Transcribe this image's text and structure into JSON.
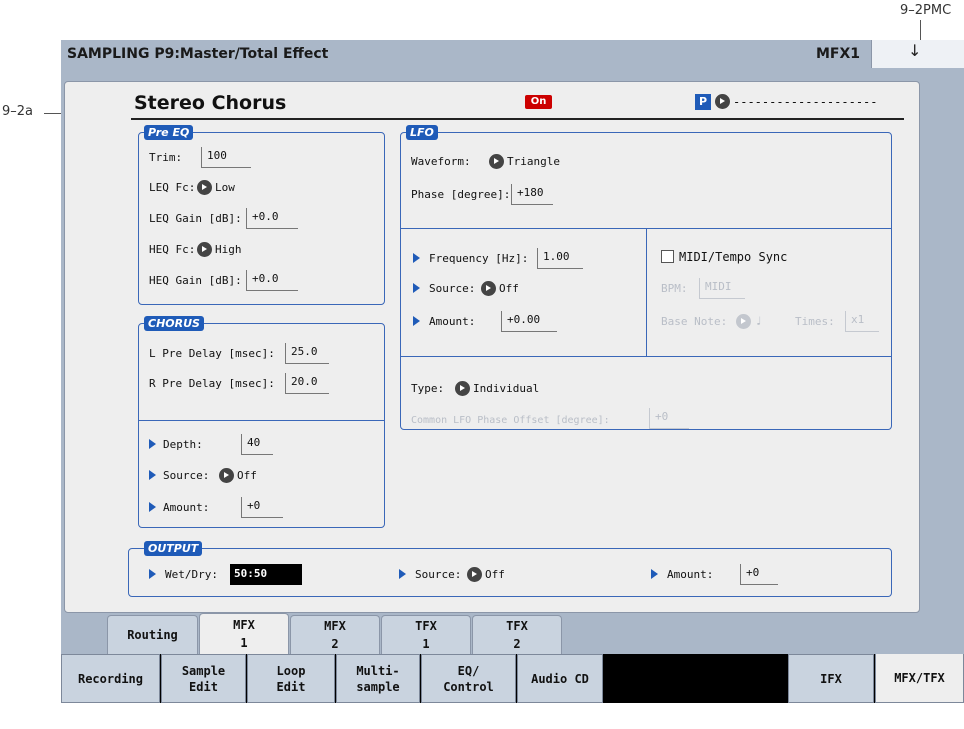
{
  "annotations": {
    "top_right": "9–2PMC",
    "left": "9–2a"
  },
  "titlebar": {
    "title": "SAMPLING P9:Master/Total Effect",
    "page_id": "MFX1"
  },
  "effect": {
    "name": "Stereo Chorus",
    "on_badge": "On",
    "p_badge": "P",
    "dashes": "--------------------"
  },
  "pre_eq": {
    "section": "Pre EQ",
    "trim_label": "Trim:",
    "trim_value": "100",
    "leq_fc_label": "LEQ Fc:",
    "leq_fc_value": "Low",
    "leq_gain_label": "LEQ Gain [dB]:",
    "leq_gain_value": "+0.0",
    "heq_fc_label": "HEQ Fc:",
    "heq_fc_value": "High",
    "heq_gain_label": "HEQ Gain [dB]:",
    "heq_gain_value": "+0.0"
  },
  "chorus": {
    "section": "CHORUS",
    "l_pre_delay_label": "L Pre Delay [msec]:",
    "l_pre_delay_value": "25.0",
    "r_pre_delay_label": "R Pre Delay [msec]:",
    "r_pre_delay_value": "20.0",
    "depth_label": "Depth:",
    "depth_value": "40",
    "source_label": "Source:",
    "source_value": "Off",
    "amount_label": "Amount:",
    "amount_value": "+0"
  },
  "lfo": {
    "section": "LFO",
    "waveform_label": "Waveform:",
    "waveform_value": "Triangle",
    "phase_label": "Phase [degree]:",
    "phase_value": "+180",
    "frequency_label": "Frequency [Hz]:",
    "frequency_value": "1.00",
    "source_label": "Source:",
    "source_value": "Off",
    "amount_label": "Amount:",
    "amount_value": "+0.00",
    "midi_sync_label": "MIDI/Tempo Sync",
    "bpm_label": "BPM:",
    "bpm_value": "MIDI",
    "base_note_label": "Base Note:",
    "base_note_value": "♩",
    "times_label": "Times:",
    "times_value": "x1",
    "type_label": "Type:",
    "type_value": "Individual",
    "common_phase_label": "Common LFO Phase Offset [degree]:",
    "common_phase_value": "+0"
  },
  "output": {
    "section": "OUTPUT",
    "wetdry_label": "Wet/Dry:",
    "wetdry_value": "50:50",
    "source_label": "Source:",
    "source_value": "Off",
    "amount_label": "Amount:",
    "amount_value": "+0"
  },
  "page_tabs": [
    {
      "l1": "Routing",
      "l2": ""
    },
    {
      "l1": "MFX",
      "l2": "1"
    },
    {
      "l1": "MFX",
      "l2": "2"
    },
    {
      "l1": "TFX",
      "l2": "1"
    },
    {
      "l1": "TFX",
      "l2": "2"
    }
  ],
  "mode_tabs": [
    {
      "l1": "Recording",
      "l2": ""
    },
    {
      "l1": "Sample",
      "l2": "Edit"
    },
    {
      "l1": "Loop",
      "l2": "Edit"
    },
    {
      "l1": "Multi-",
      "l2": "sample"
    },
    {
      "l1": "EQ/",
      "l2": "Control"
    },
    {
      "l1": "Audio CD",
      "l2": ""
    },
    {
      "l1": "IFX",
      "l2": ""
    },
    {
      "l1": "MFX/TFX",
      "l2": ""
    }
  ]
}
